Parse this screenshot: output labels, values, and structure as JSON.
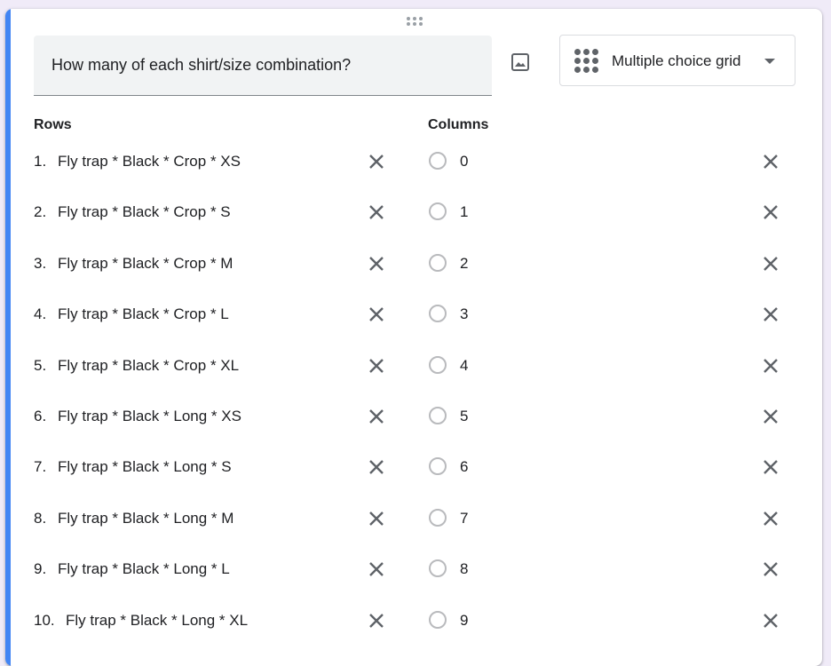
{
  "question": {
    "title": "How many of each shirt/size combination?",
    "type_label": "Multiple choice grid"
  },
  "icons": {
    "drag": "drag-handle-icon",
    "image": "image-icon",
    "type": "grid-icon",
    "dropdown": "chevron-down-icon",
    "remove": "close-icon",
    "radio": "radio-circle-icon"
  },
  "colors": {
    "accent": "#4285f4",
    "text": "#202124",
    "icon": "#5f6368"
  },
  "rows_label": "Rows",
  "columns_label": "Columns",
  "rows": [
    {
      "num": "1.",
      "label": "Fly trap * Black * Crop * XS"
    },
    {
      "num": "2.",
      "label": "Fly trap * Black * Crop * S"
    },
    {
      "num": "3.",
      "label": "Fly trap * Black * Crop * M"
    },
    {
      "num": "4.",
      "label": "Fly trap * Black * Crop * L"
    },
    {
      "num": "5.",
      "label": "Fly trap * Black * Crop * XL"
    },
    {
      "num": "6.",
      "label": "Fly trap * Black * Long * XS"
    },
    {
      "num": "7.",
      "label": "Fly trap * Black * Long * S"
    },
    {
      "num": "8.",
      "label": "Fly trap * Black * Long * M"
    },
    {
      "num": "9.",
      "label": "Fly trap * Black * Long * L"
    },
    {
      "num": "10.",
      "label": "Fly trap * Black * Long * XL"
    }
  ],
  "columns": [
    {
      "label": "0"
    },
    {
      "label": "1"
    },
    {
      "label": "2"
    },
    {
      "label": "3"
    },
    {
      "label": "4"
    },
    {
      "label": "5"
    },
    {
      "label": "6"
    },
    {
      "label": "7"
    },
    {
      "label": "8"
    },
    {
      "label": "9"
    }
  ]
}
